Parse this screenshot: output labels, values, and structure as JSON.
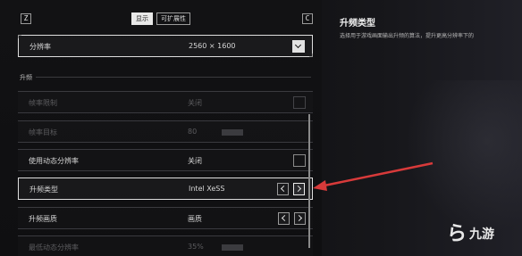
{
  "keys": {
    "left": "Z",
    "right": "C"
  },
  "tabs": [
    {
      "label": "显示",
      "active": true
    },
    {
      "label": "可扩展性",
      "active": false
    }
  ],
  "section_header": "升频",
  "rows": {
    "resolution": {
      "label": "分辨率",
      "value": "2560 × 1600"
    },
    "frame_limit": {
      "label": "帧率限制",
      "value": "关闭"
    },
    "frame_target": {
      "label": "帧率目标",
      "value": "80"
    },
    "dynamic_res": {
      "label": "使用动态分辨率",
      "value": "关闭"
    },
    "upscale_type": {
      "label": "升频类型",
      "value": "Intel XeSS"
    },
    "upscale_quality": {
      "label": "升频画质",
      "value": "画质"
    },
    "min_dynamic_res": {
      "label": "最低动态分辨率",
      "value": "35%"
    }
  },
  "side_panel": {
    "title": "升频类型",
    "description": "选择用于游戏画面输出升频的算法，提升更高分辨率下的"
  },
  "watermark": {
    "mark": "ら",
    "text": "九游"
  },
  "annotation_color": "#d83a3a"
}
